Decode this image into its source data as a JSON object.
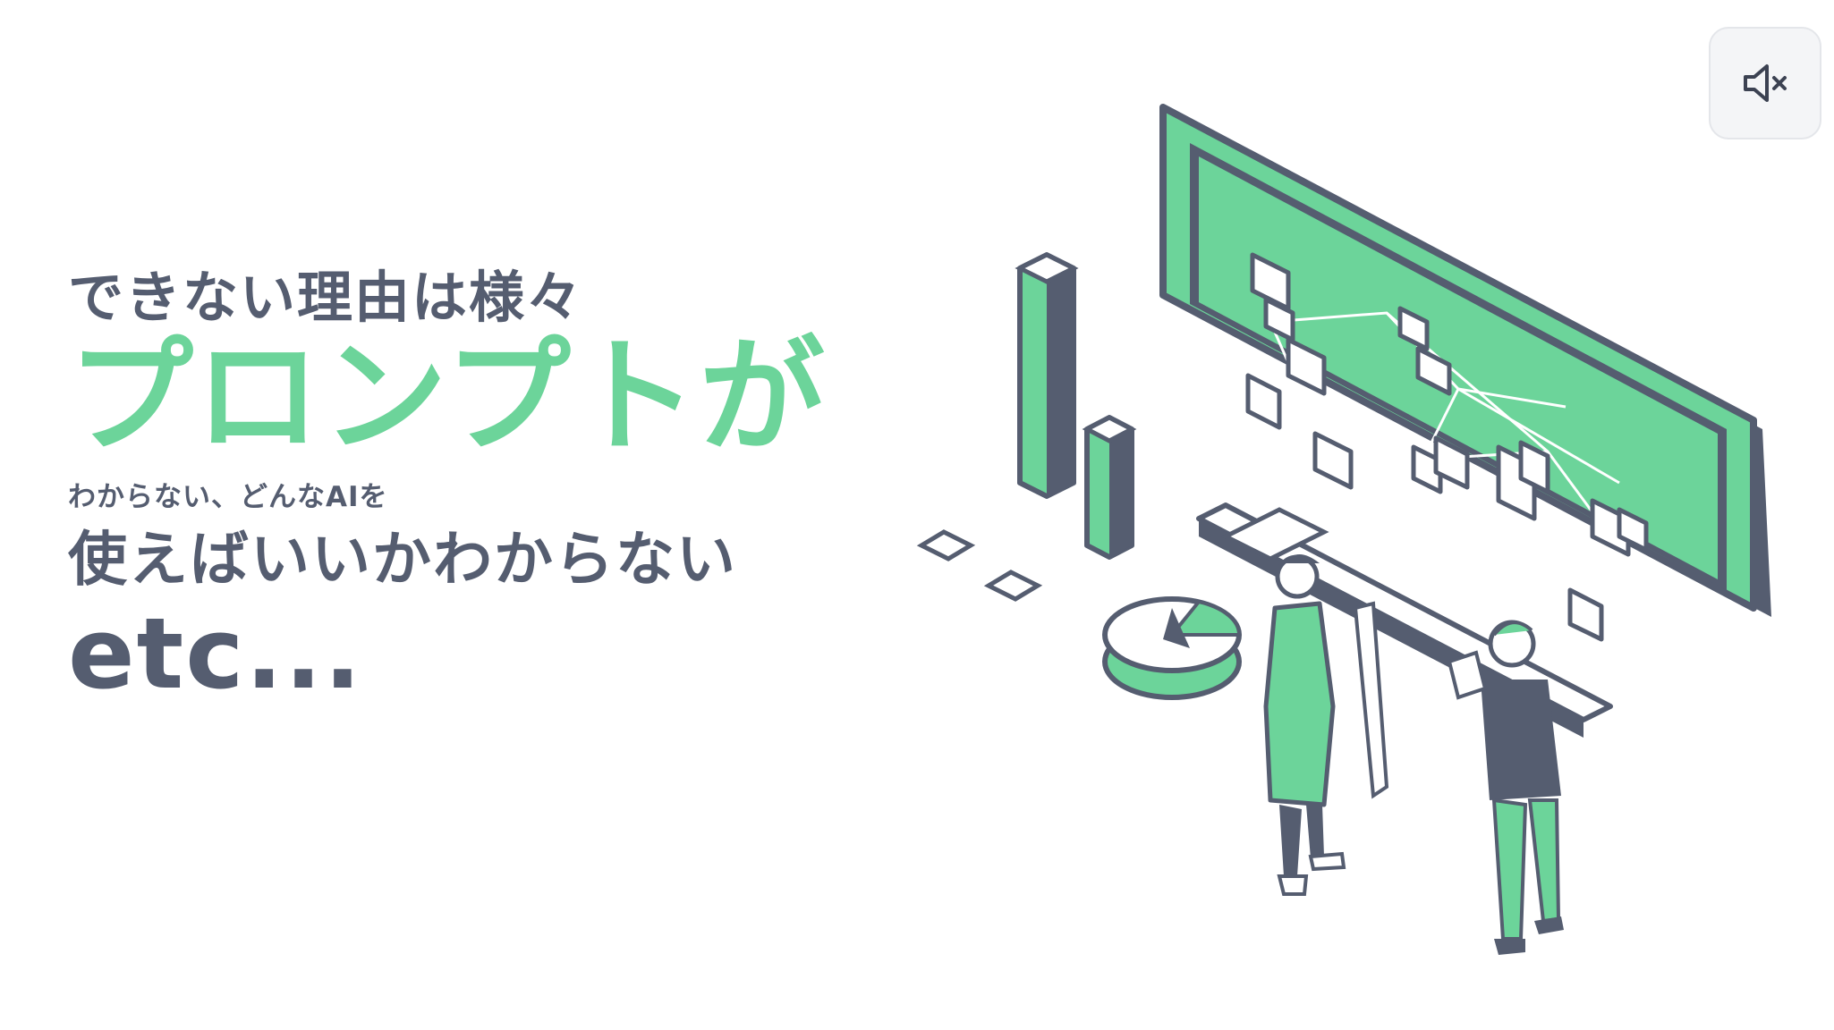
{
  "colors": {
    "dark": "#555d70",
    "green": "#6cd49a",
    "white": "#ffffff",
    "button_bg": "#f4f5f7"
  },
  "slide": {
    "line1": "できない理由は様々",
    "line2": "プロンプトが",
    "line3": "わからない、どんなAIを",
    "line4": "使えばいいかわからない",
    "line5": "etc..."
  },
  "controls": {
    "mute_icon": "speaker-muted-icon"
  }
}
